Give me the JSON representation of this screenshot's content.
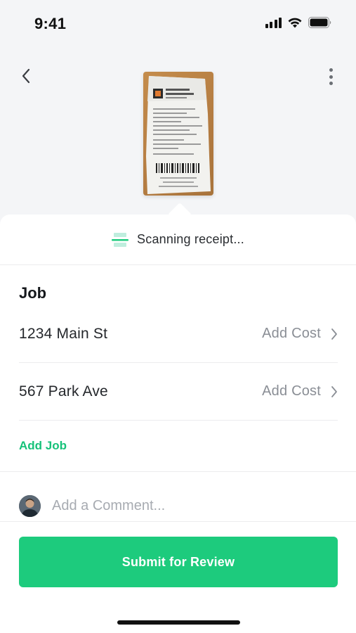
{
  "status_bar": {
    "time": "9:41",
    "icons": [
      "signal-icon",
      "wifi-icon",
      "battery-icon"
    ]
  },
  "header": {
    "back_icon": "chevron-left-icon",
    "more_icon": "more-vertical-icon",
    "receipt_image": "receipt-photo"
  },
  "scanning": {
    "icon": "scan-icon",
    "text": "Scanning receipt..."
  },
  "job_section": {
    "title": "Job",
    "jobs": [
      {
        "address": "1234 Main St",
        "action_label": "Add Cost"
      },
      {
        "address": "567 Park Ave",
        "action_label": "Add Cost"
      }
    ],
    "add_job_label": "Add Job"
  },
  "comment": {
    "placeholder": "Add a Comment..."
  },
  "footer": {
    "submit_label": "Submit for Review"
  },
  "colors": {
    "accent": "#1dcb7d",
    "background": "#f4f5f7",
    "muted_text": "#8a8e95"
  }
}
